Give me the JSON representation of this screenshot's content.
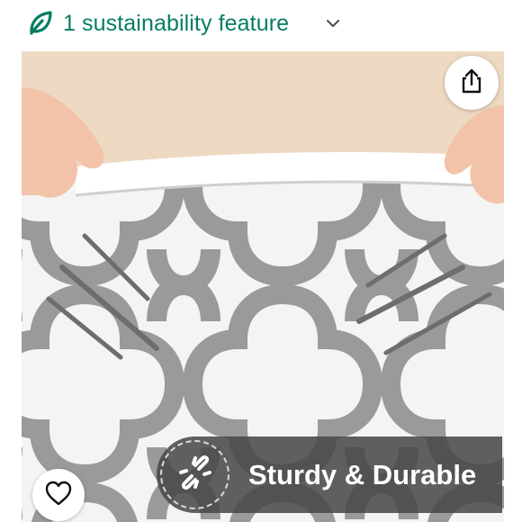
{
  "header": {
    "sustainability_label": "1 sustainability feature",
    "leaf_icon": "leaf-icon",
    "chevron_icon": "chevron-down-icon",
    "accent_color": "#067d62"
  },
  "gallery": {
    "product": "grey quatrefoil trellis shower curtain stretched by hands, claw-mark illustrations",
    "share_icon": "share-icon",
    "favorite_icon": "heart-icon",
    "feature_badge": {
      "icon": "unbreakable-link-icon",
      "text": "Sturdy & Durable"
    }
  }
}
